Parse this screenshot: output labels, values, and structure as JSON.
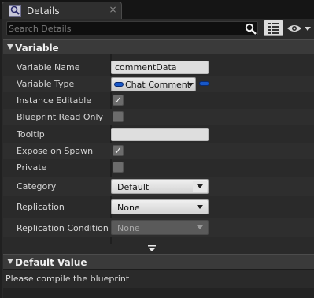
{
  "tab": {
    "title": "Details",
    "icon": "details-magnifier-icon",
    "close_glyph": "×"
  },
  "search": {
    "placeholder": "Search Details",
    "value": ""
  },
  "toolbar": {
    "view_options_icon": "list-view-icon",
    "visibility_icon": "eye-icon"
  },
  "sections": {
    "variable": {
      "title": "Variable"
    },
    "default_value": {
      "title": "Default Value",
      "message": "Please compile the blueprint"
    }
  },
  "properties": {
    "variable_name": {
      "label": "Variable Name",
      "value": "commentData"
    },
    "variable_type": {
      "label": "Variable Type",
      "value": "Chat Comment",
      "pin_color": "#1858c8"
    },
    "instance_editable": {
      "label": "Instance Editable",
      "checked": true,
      "check_glyph": "✓"
    },
    "blueprint_read_only": {
      "label": "Blueprint Read Only",
      "checked": false,
      "check_glyph": ""
    },
    "tooltip": {
      "label": "Tooltip",
      "value": ""
    },
    "expose_on_spawn": {
      "label": "Expose on Spawn",
      "checked": true,
      "check_glyph": "✓"
    },
    "private": {
      "label": "Private",
      "checked": false,
      "check_glyph": ""
    },
    "category": {
      "label": "Category",
      "value": "Default"
    },
    "replication": {
      "label": "Replication",
      "value": "None"
    },
    "replication_condition": {
      "label": "Replication Condition",
      "value": "None",
      "enabled": false
    }
  },
  "colors": {
    "panel_bg": "#2a2a2a",
    "header_bg": "#3a3a3a",
    "accent_blue": "#1858c8"
  }
}
